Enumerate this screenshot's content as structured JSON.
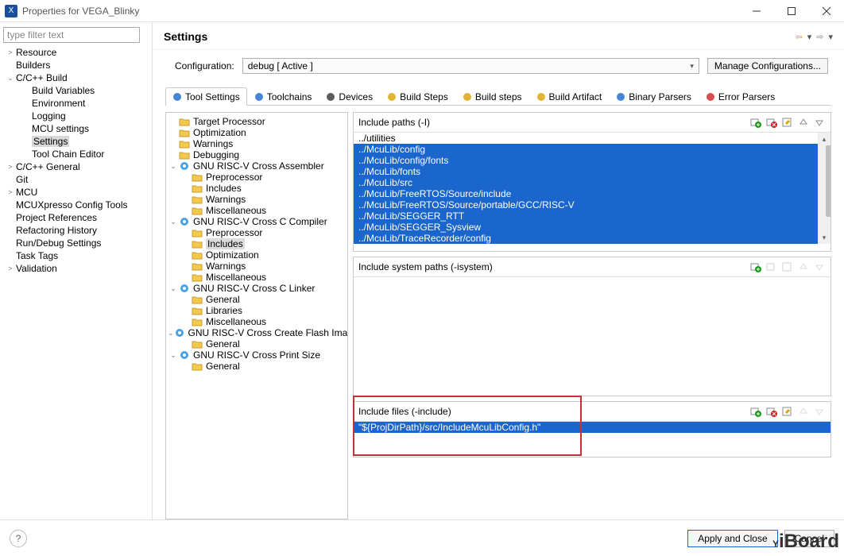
{
  "window": {
    "title": "Properties for VEGA_Blinky"
  },
  "filter_placeholder": "type filter text",
  "left_tree": {
    "items": [
      {
        "label": "Resource",
        "arrow": ">"
      },
      {
        "label": "Builders"
      },
      {
        "label": "C/C++ Build",
        "arrow": "v",
        "children": [
          {
            "label": "Build Variables"
          },
          {
            "label": "Environment"
          },
          {
            "label": "Logging"
          },
          {
            "label": "MCU settings"
          },
          {
            "label": "Settings",
            "selected": true
          },
          {
            "label": "Tool Chain Editor"
          }
        ]
      },
      {
        "label": "C/C++ General",
        "arrow": ">"
      },
      {
        "label": "Git"
      },
      {
        "label": "MCU",
        "arrow": ">"
      },
      {
        "label": "MCUXpresso Config Tools"
      },
      {
        "label": "Project References"
      },
      {
        "label": "Refactoring History"
      },
      {
        "label": "Run/Debug Settings"
      },
      {
        "label": "Task Tags"
      },
      {
        "label": "Validation",
        "arrow": ">"
      }
    ]
  },
  "header": {
    "title": "Settings"
  },
  "config": {
    "label": "Configuration:",
    "value": "debug  [ Active ]",
    "manage": "Manage Configurations..."
  },
  "tabs": [
    {
      "label": "Tool Settings",
      "active": true
    },
    {
      "label": "Toolchains"
    },
    {
      "label": "Devices"
    },
    {
      "label": "Build Steps"
    },
    {
      "label": "Build steps"
    },
    {
      "label": "Build Artifact"
    },
    {
      "label": "Binary Parsers"
    },
    {
      "label": "Error Parsers"
    }
  ],
  "mid_tree": [
    {
      "label": "Target Processor",
      "icon": "folder"
    },
    {
      "label": "Optimization",
      "icon": "folder"
    },
    {
      "label": "Warnings",
      "icon": "folder"
    },
    {
      "label": "Debugging",
      "icon": "folder"
    },
    {
      "label": "GNU RISC-V Cross Assembler",
      "icon": "tool",
      "arrow": "v",
      "children": [
        {
          "label": "Preprocessor",
          "icon": "folder"
        },
        {
          "label": "Includes",
          "icon": "folder"
        },
        {
          "label": "Warnings",
          "icon": "folder"
        },
        {
          "label": "Miscellaneous",
          "icon": "folder"
        }
      ]
    },
    {
      "label": "GNU RISC-V Cross C Compiler",
      "icon": "tool",
      "arrow": "v",
      "children": [
        {
          "label": "Preprocessor",
          "icon": "folder"
        },
        {
          "label": "Includes",
          "icon": "folder",
          "selected": true
        },
        {
          "label": "Optimization",
          "icon": "folder"
        },
        {
          "label": "Warnings",
          "icon": "folder"
        },
        {
          "label": "Miscellaneous",
          "icon": "folder"
        }
      ]
    },
    {
      "label": "GNU RISC-V Cross C Linker",
      "icon": "tool",
      "arrow": "v",
      "children": [
        {
          "label": "General",
          "icon": "folder"
        },
        {
          "label": "Libraries",
          "icon": "folder"
        },
        {
          "label": "Miscellaneous",
          "icon": "folder"
        }
      ]
    },
    {
      "label": "GNU RISC-V Cross Create Flash Image",
      "icon": "tool",
      "arrow": "v",
      "children": [
        {
          "label": "General",
          "icon": "folder"
        }
      ]
    },
    {
      "label": "GNU RISC-V Cross Print Size",
      "icon": "tool",
      "arrow": "v",
      "children": [
        {
          "label": "General",
          "icon": "folder"
        }
      ]
    }
  ],
  "panels": {
    "p1": {
      "title": "Include paths (-I)",
      "items": [
        "../utilities",
        "../McuLib/config",
        "../McuLib/config/fonts",
        "../McuLib/fonts",
        "../McuLib/src",
        "../McuLib/FreeRTOS/Source/include",
        "../McuLib/FreeRTOS/Source/portable/GCC/RISC-V",
        "../McuLib/SEGGER_RTT",
        "../McuLib/SEGGER_Sysview",
        "../McuLib/TraceRecorder/config"
      ]
    },
    "p2": {
      "title": "Include system paths (-isystem)"
    },
    "p3": {
      "title": "Include files (-include)",
      "items": [
        "\"${ProjDirPath}/src/IncludeMcuLibConfig.h\""
      ]
    }
  },
  "footer": {
    "apply": "Apply and Close",
    "cancel": "Cancel"
  },
  "watermark": "iBoard"
}
